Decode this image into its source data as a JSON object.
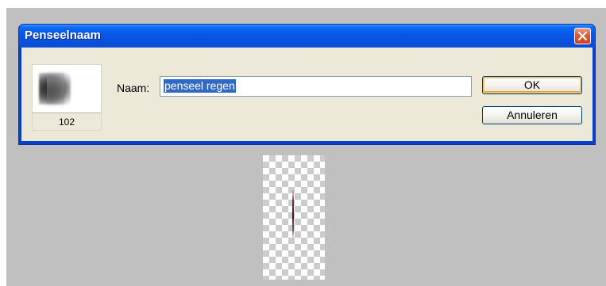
{
  "dialog": {
    "title": "Penseelnaam",
    "close_icon": "close-icon",
    "brush": {
      "size": "102"
    },
    "name_label": "Naam:",
    "name_value": "penseel regen",
    "ok_label": "OK",
    "cancel_label": "Annuleren"
  },
  "colors": {
    "titlebar": "#0a5ae6",
    "dialog_body": "#ece9d8",
    "selection": "#316ac5",
    "workspace": "#c0c0c0"
  }
}
